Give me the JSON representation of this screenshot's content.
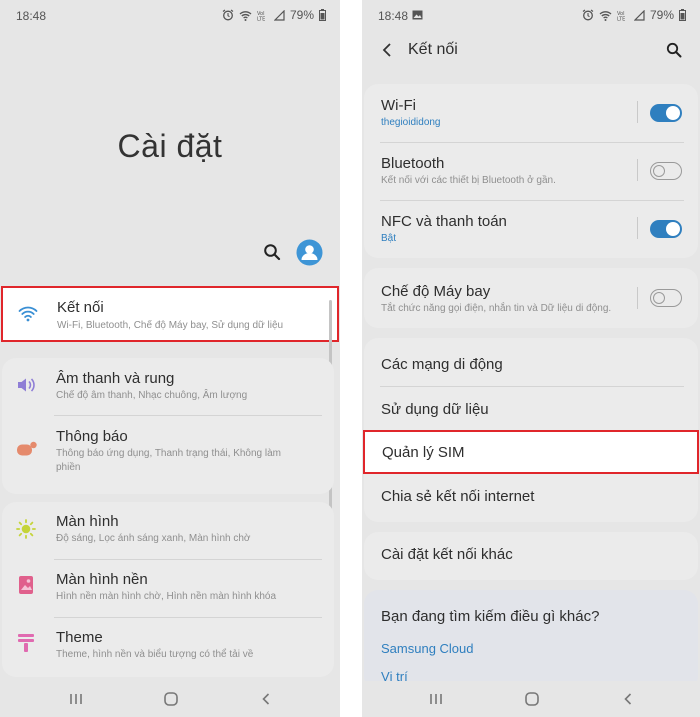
{
  "left": {
    "status": {
      "time": "18:48",
      "battery": "79%"
    },
    "page_title": "Cài đặt",
    "items": [
      {
        "title": "Kết nối",
        "subtitle": "Wi-Fi, Bluetooth, Chế độ Máy bay, Sử dụng dữ liệu",
        "icon": "wifi-icon"
      },
      {
        "title": "Âm thanh và rung",
        "subtitle": "Chế độ âm thanh, Nhạc chuông, Âm lượng",
        "icon": "volume-icon"
      },
      {
        "title": "Thông báo",
        "subtitle": "Thông báo ứng dụng, Thanh trạng thái, Không làm phiền",
        "icon": "notification-icon"
      },
      {
        "title": "Màn hình",
        "subtitle": "Độ sáng, Lọc ánh sáng xanh, Màn hình chờ",
        "icon": "brightness-icon"
      },
      {
        "title": "Màn hình nền",
        "subtitle": "Hình nền màn hình chờ, Hình nền màn hình khóa",
        "icon": "wallpaper-icon"
      },
      {
        "title": "Theme",
        "subtitle": "Theme, hình nền và biểu tượng có thể tải về",
        "icon": "theme-icon"
      }
    ]
  },
  "right": {
    "status": {
      "time": "18:48",
      "battery": "79%"
    },
    "header_title": "Kết nối",
    "items": [
      {
        "title": "Wi-Fi",
        "subtitle": "thegioididong",
        "toggle": "on"
      },
      {
        "title": "Bluetooth",
        "subtitle": "Kết nối với các thiết bị Bluetooth ở gần.",
        "toggle": "off"
      },
      {
        "title": "NFC và thanh toán",
        "subtitle": "Bật",
        "toggle": "on"
      },
      {
        "title": "Chế độ Máy bay",
        "subtitle": "Tắt chức năng gọi điện, nhắn tin và Dữ liệu di động.",
        "toggle": "off"
      },
      {
        "title": "Các mạng di động"
      },
      {
        "title": "Sử dụng dữ liệu"
      },
      {
        "title": "Quản lý SIM"
      },
      {
        "title": "Chia sẻ kết nối internet"
      },
      {
        "title": "Cài đặt kết nối khác"
      }
    ],
    "suggest": {
      "question": "Bạn đang tìm kiếm điều gì khác?",
      "links": [
        "Samsung Cloud",
        "Vị trí"
      ]
    }
  },
  "colors": {
    "accent": "#2f7fbf",
    "highlight": "#e0262b",
    "background": "#e6e6e6"
  }
}
